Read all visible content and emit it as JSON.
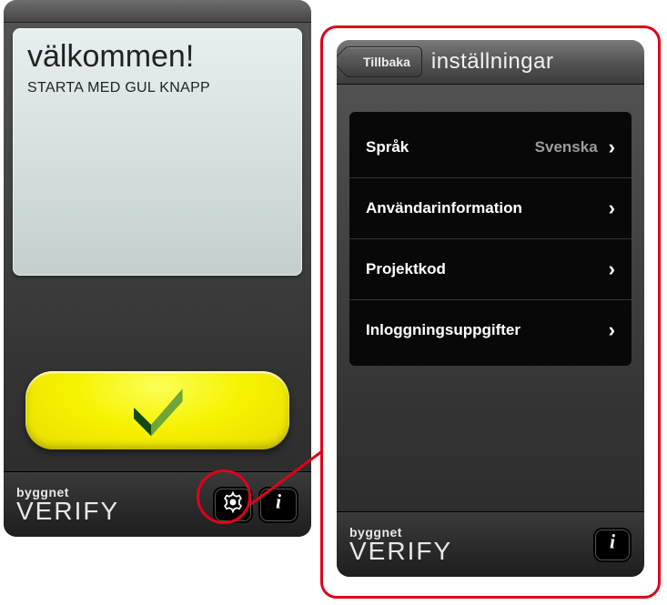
{
  "phone1": {
    "welcome_title": "välkommen!",
    "welcome_subtitle": "STARTA MED GUL KNAPP",
    "brand_small": "byggnet",
    "brand_big": "VERIFY"
  },
  "phone2": {
    "back_label": "Tillbaka",
    "nav_title": "inställningar",
    "brand_small": "byggnet",
    "brand_big": "VERIFY",
    "settings": [
      {
        "label": "Språk",
        "value": "Svenska"
      },
      {
        "label": "Användarinformation",
        "value": ""
      },
      {
        "label": "Projektkod",
        "value": ""
      },
      {
        "label": "Inloggningsuppgifter",
        "value": ""
      }
    ]
  },
  "icons": {
    "gear": "gear-icon",
    "info": "info-icon",
    "verify_mark": "verify-mark-icon",
    "chevron_right": "›"
  },
  "colors": {
    "highlight": "#e0001a",
    "yellow": "#f6f300"
  }
}
